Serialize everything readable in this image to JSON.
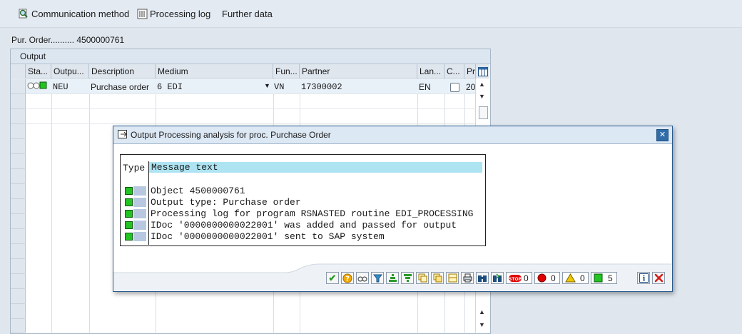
{
  "toolbar": {
    "communication_method": "Communication method",
    "processing_log": "Processing log",
    "further_data": "Further data"
  },
  "po": {
    "label": "Pur. Order..........",
    "number": "4500000761"
  },
  "output": {
    "title": "Output",
    "columns": [
      "Sta...",
      "Outpu...",
      "Description",
      "Medium",
      "Fun...",
      "Partner",
      "Lan...",
      "C...",
      "Pr"
    ],
    "row": {
      "output_type": "NEU",
      "description": "Purchase order",
      "medium": "6 EDI",
      "function": "VN",
      "partner": "17300002",
      "language": "EN",
      "processing_date": "20"
    }
  },
  "dialog": {
    "title": "Output Processing analysis for proc. Purchase Order",
    "header_type": "Type",
    "header_message": "Message text",
    "messages": [
      "Object 4500000761",
      "Output type: Purchase order",
      "Processing log for program RSNASTED routine EDI_PROCESSING",
      "IDoc '0000000000022001' was added and passed for output",
      "IDoc '0000000000022001' sent to SAP system"
    ],
    "counts": {
      "stop": "0",
      "error": "0",
      "warning": "0",
      "success": "5"
    }
  },
  "colors": {
    "success": "#22c322",
    "error": "#e00000",
    "warning": "#f0c800",
    "accent": "#2f6ca8"
  }
}
